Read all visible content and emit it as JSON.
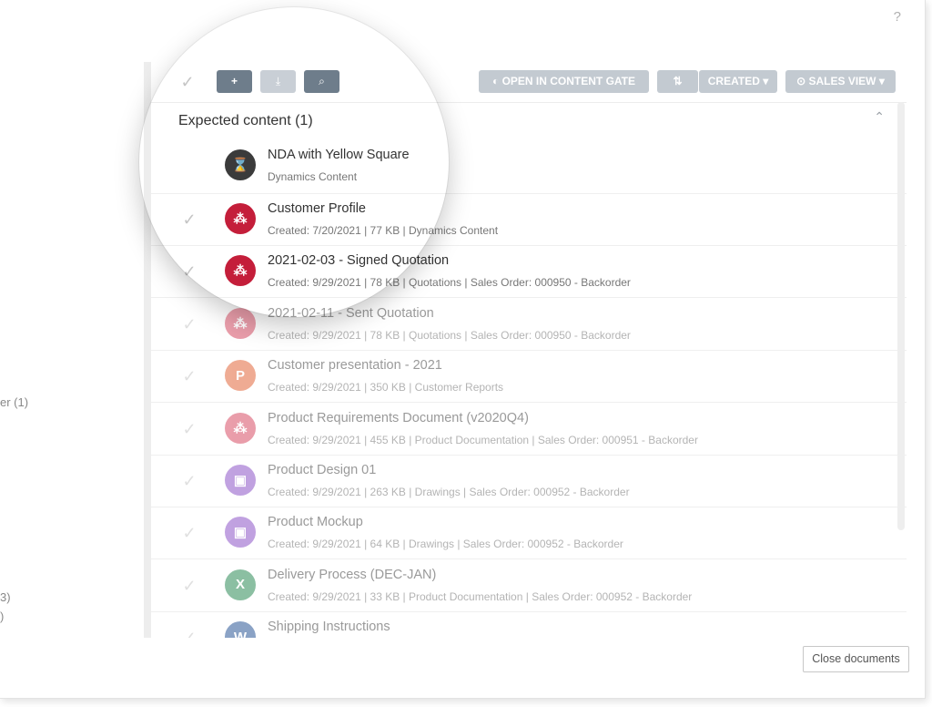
{
  "help": "?",
  "left_panel": {
    "text_1": "er (1)",
    "text_2": "3)",
    "text_3": ")"
  },
  "toolbar": {
    "check": "✓",
    "add": "+",
    "download": "⤓",
    "search": "⌕",
    "open_in_content_gate": "OPEN IN CONTENT GATE",
    "sort_icon": "⇅",
    "sort_label": "CREATED",
    "view_label": "SALES VIEW",
    "caret": "▾"
  },
  "section": {
    "title": "Expected content (1)",
    "collapse": "⌃"
  },
  "expected": {
    "title": "NDA with Yellow Square",
    "meta": "Dynamics Content",
    "icon": "⌛"
  },
  "documents": [
    {
      "title": "Customer Profile",
      "meta": "Created: 7/20/2021 | 77 KB | Dynamics Content",
      "icon_glyph": "⁂",
      "icon_color": "#c41e3a"
    },
    {
      "title": "2021-02-03 - Signed Quotation",
      "meta": "Created: 9/29/2021 | 78 KB | Quotations | Sales Order: 000950 - Backorder",
      "icon_glyph": "⁂",
      "icon_color": "#c41e3a"
    },
    {
      "title": "2021-02-11 - Sent Quotation",
      "meta": "Created: 9/29/2021 | 78 KB | Quotations | Sales Order: 000950 - Backorder",
      "icon_glyph": "⁂",
      "icon_color": "#d84e66"
    },
    {
      "title": "Customer presentation - 2021",
      "meta": "Created: 9/29/2021 | 350 KB | Customer Reports",
      "icon_glyph": "P",
      "icon_color": "#e2683c"
    },
    {
      "title": "Product Requirements Document (v2020Q4)",
      "meta": "Created: 9/29/2021 | 455 KB | Product Documentation | Sales Order: 000951 - Backorder",
      "icon_glyph": "⁂",
      "icon_color": "#d84e66"
    },
    {
      "title": "Product Design 01",
      "meta": "Created: 9/29/2021 | 263 KB | Drawings | Sales Order: 000952 - Backorder",
      "icon_glyph": "▣",
      "icon_color": "#8e55c8"
    },
    {
      "title": "Product Mockup",
      "meta": "Created: 9/29/2021 | 64 KB | Drawings | Sales Order: 000952 - Backorder",
      "icon_glyph": "▣",
      "icon_color": "#8e55c8"
    },
    {
      "title": "Delivery Process (DEC-JAN)",
      "meta": "Created: 9/29/2021 | 33 KB | Product Documentation | Sales Order: 000952 - Backorder",
      "icon_glyph": "X",
      "icon_color": "#2e8b57"
    },
    {
      "title": "Shipping Instructions",
      "meta": "",
      "icon_glyph": "W",
      "icon_color": "#2b5797"
    }
  ],
  "footer": {
    "close_documents": "Close documents"
  }
}
